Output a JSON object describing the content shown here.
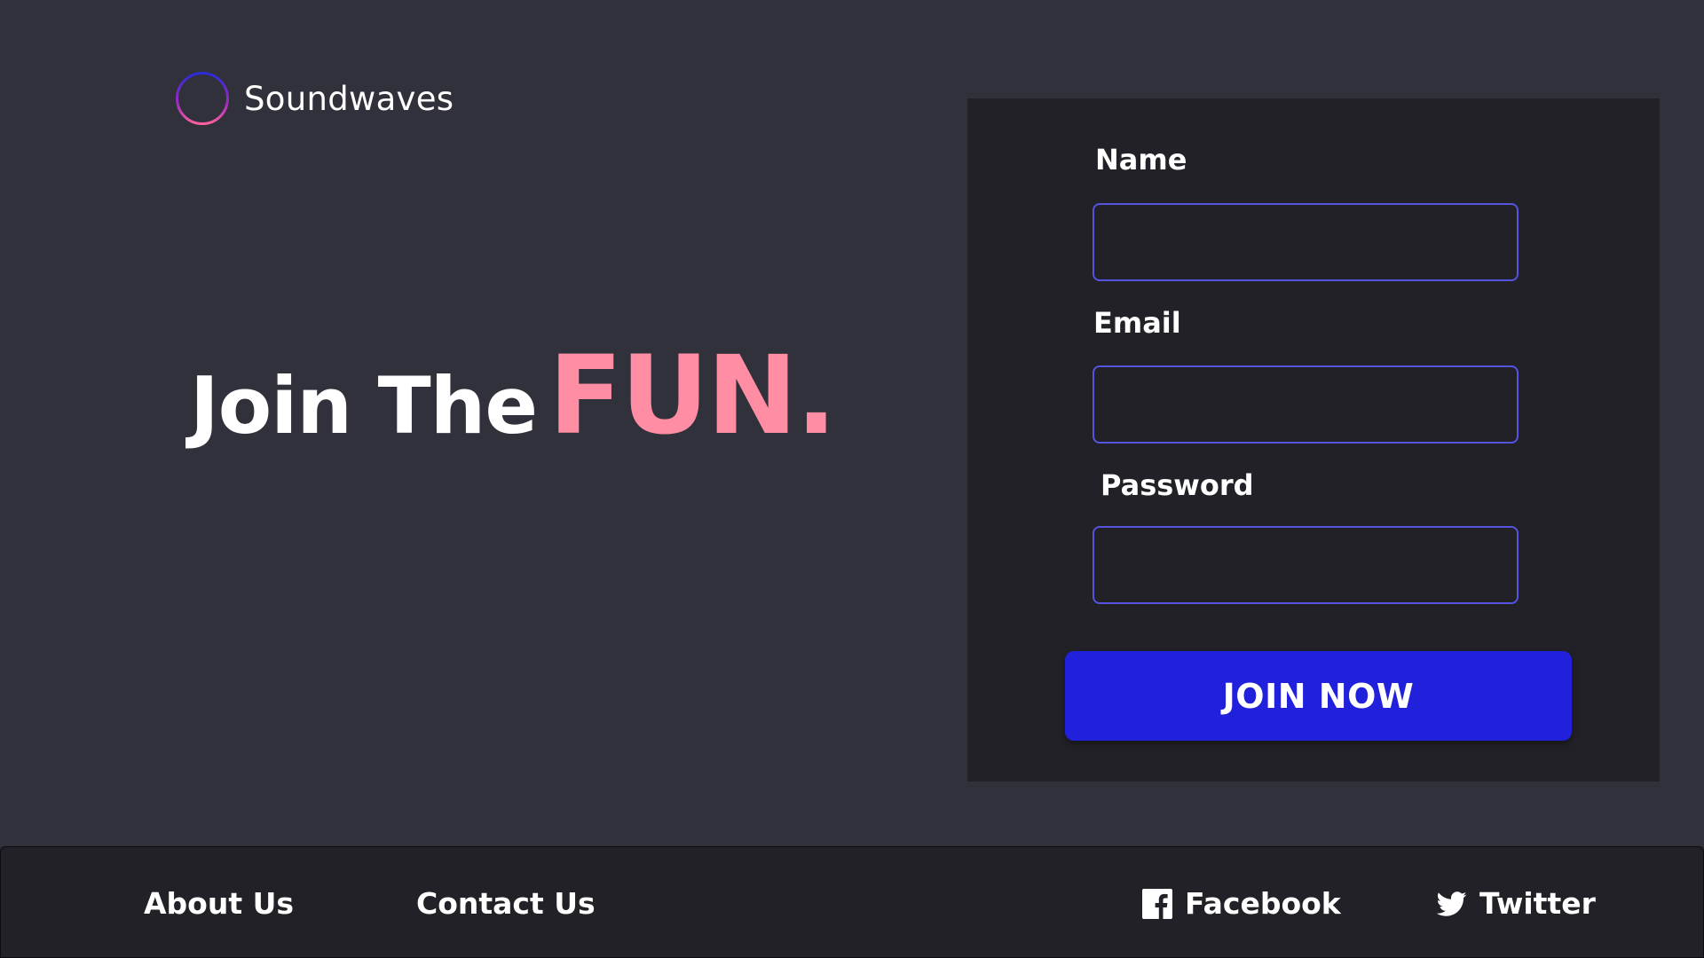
{
  "brand": {
    "name": "Soundwaves",
    "logo_icon": "soundwave-circle-icon",
    "logo_gradient": [
      "#2b2bd8",
      "#c02bb0",
      "#ff5fa0"
    ]
  },
  "hero": {
    "headline": "Join The",
    "accent": "FUN.",
    "accent_color": "#ff8ea4"
  },
  "form": {
    "fields": [
      {
        "label": "Name",
        "value": "",
        "placeholder": ""
      },
      {
        "label": "Email",
        "value": "",
        "placeholder": ""
      },
      {
        "label": "Password",
        "value": "",
        "placeholder": ""
      }
    ],
    "submit_label": "JOIN NOW",
    "input_border_color": "#5553e0",
    "button_color": "#2121dc"
  },
  "footer": {
    "links": [
      {
        "label": "About Us"
      },
      {
        "label": "Contact Us"
      }
    ],
    "social": [
      {
        "label": "Facebook",
        "icon": "facebook-icon"
      },
      {
        "label": "Twitter",
        "icon": "twitter-icon"
      }
    ]
  },
  "colors": {
    "background": "#31313b",
    "panel": "#212127",
    "text": "#ffffff"
  }
}
